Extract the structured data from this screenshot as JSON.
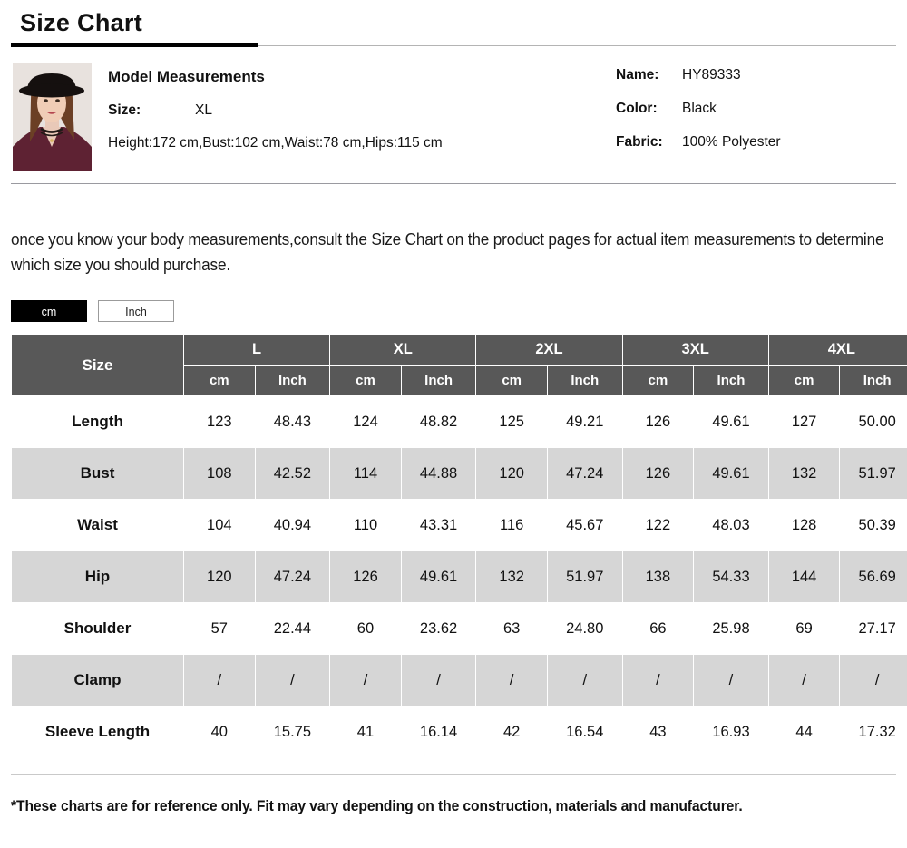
{
  "page": {
    "title": "Size Chart"
  },
  "model": {
    "heading": "Model Measurements",
    "size_label": "Size:",
    "size_value": "XL",
    "measurements": "Height:172 cm,Bust:102 cm,Waist:78 cm,Hips:115 cm",
    "image_alt": "model-thumbnail"
  },
  "specs": {
    "name_label": "Name:",
    "name_value": "HY89333",
    "color_label": "Color:",
    "color_value": "Black",
    "fabric_label": "Fabric:",
    "fabric_value": "100% Polyester"
  },
  "intro": "once you know your body measurements,consult the Size Chart on the product pages for actual item measurements to determine which size you should purchase.",
  "units": {
    "cm_label": "cm",
    "inch_label": "Inch",
    "active": "cm"
  },
  "table": {
    "corner_label": "Size",
    "sizes": [
      "L",
      "XL",
      "2XL",
      "3XL",
      "4XL"
    ],
    "sub_headers": [
      "cm",
      "Inch"
    ],
    "rows": [
      {
        "label": "Length",
        "values": [
          "123",
          "48.43",
          "124",
          "48.82",
          "125",
          "49.21",
          "126",
          "49.61",
          "127",
          "50.00"
        ]
      },
      {
        "label": "Bust",
        "values": [
          "108",
          "42.52",
          "114",
          "44.88",
          "120",
          "47.24",
          "126",
          "49.61",
          "132",
          "51.97"
        ]
      },
      {
        "label": "Waist",
        "values": [
          "104",
          "40.94",
          "110",
          "43.31",
          "116",
          "45.67",
          "122",
          "48.03",
          "128",
          "50.39"
        ]
      },
      {
        "label": "Hip",
        "values": [
          "120",
          "47.24",
          "126",
          "49.61",
          "132",
          "51.97",
          "138",
          "54.33",
          "144",
          "56.69"
        ]
      },
      {
        "label": "Shoulder",
        "values": [
          "57",
          "22.44",
          "60",
          "23.62",
          "63",
          "24.80",
          "66",
          "25.98",
          "69",
          "27.17"
        ]
      },
      {
        "label": "Clamp",
        "values": [
          "/",
          "/",
          "/",
          "/",
          "/",
          "/",
          "/",
          "/",
          "/",
          "/"
        ]
      },
      {
        "label": "Sleeve Length",
        "values": [
          "40",
          "15.75",
          "41",
          "16.14",
          "42",
          "16.54",
          "43",
          "16.93",
          "44",
          "17.32"
        ]
      }
    ]
  },
  "footnote": "*These charts are for reference only. Fit may vary depending on the construction, materials and manufacturer.",
  "colors": {
    "header_gray": "#585858",
    "alt_row_gray": "#d6d6d6",
    "accent_black": "#000000",
    "divider_gray": "#9a9aa0"
  }
}
